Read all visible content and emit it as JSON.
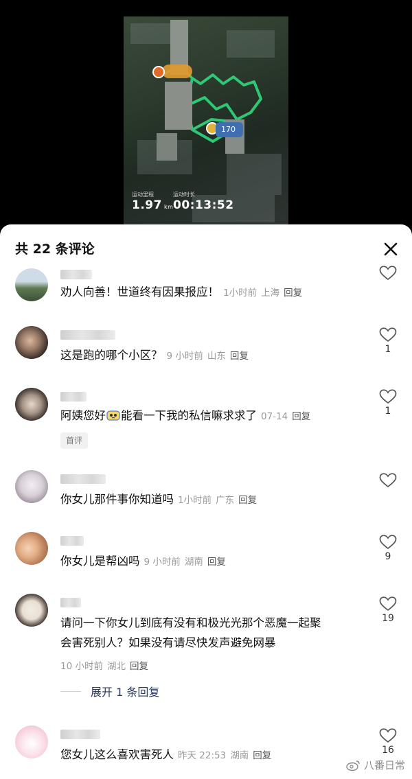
{
  "video": {
    "stats": {
      "distance_label": "运动里程",
      "distance_value": "1.97",
      "distance_unit": "km",
      "time_label": "运动时长",
      "time_value": "00:13:52"
    },
    "badge_number": "170"
  },
  "sheet": {
    "title": "共 22 条评论",
    "close_icon": "close-icon"
  },
  "comments": [
    {
      "text": "劝人向善！世道终有因果报应！",
      "time": "1小时前",
      "location": "上海",
      "reply": "回复",
      "likes": ""
    },
    {
      "text": "这是跑的哪个小区？",
      "time": "9 小时前",
      "location": "山东",
      "reply": "回复",
      "likes": "1"
    },
    {
      "text": "阿姨您好",
      "text_after": "能看一下我的私信嘛求求了",
      "time": "07-14",
      "location": "",
      "reply": "回复",
      "likes": "1",
      "tag": "首评"
    },
    {
      "text": "你女儿那件事你知道吗",
      "time": "1小时前",
      "location": "广东",
      "reply": "回复",
      "likes": ""
    },
    {
      "text": "你女儿是帮凶吗",
      "time": "9 小时前",
      "location": "湖南",
      "reply": "回复",
      "likes": "9"
    },
    {
      "text_line1": "请问一下你女儿到底有没有和极光光那个恶魔一起聚",
      "text_line2": "会害死别人？如果没有请尽快发声避免网暴",
      "time": "10 小时前",
      "location": "湖北",
      "reply": "回复",
      "likes": "19",
      "expand": "展开 1 条回复"
    },
    {
      "text": "您女儿这么喜欢害死人",
      "time": "昨天 22:53",
      "location": "湖南",
      "reply": "回复",
      "likes": "16"
    }
  ],
  "watermark": "八番日常",
  "colors": {
    "sheet_bg": "#ffffff",
    "text": "#111111",
    "meta": "#9a9a9a",
    "route": "#2fd07a",
    "expand_text": "#2c3a5c"
  }
}
